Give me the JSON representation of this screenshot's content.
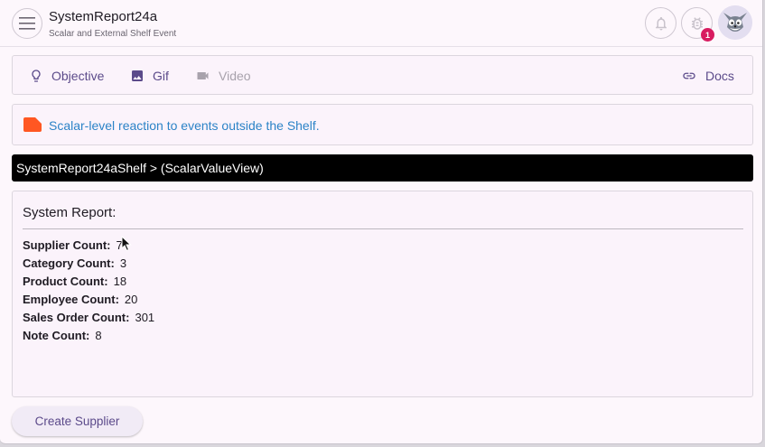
{
  "header": {
    "title": "SystemReport24a",
    "subtitle": "Scalar and External Shelf Event",
    "notification_count": "1"
  },
  "tabs": [
    {
      "label": "Objective",
      "icon": "lightbulb-icon",
      "enabled": true
    },
    {
      "label": "Gif",
      "icon": "image-icon",
      "enabled": true
    },
    {
      "label": "Video",
      "icon": "videocam-icon",
      "enabled": false
    },
    {
      "label": "Docs",
      "icon": "link-icon",
      "enabled": true
    }
  ],
  "info": {
    "icon": "label-icon",
    "icon_color": "#ff5722",
    "text": "Scalar-level reaction to events outside the Shelf."
  },
  "path": "SystemReport24aShelf > (ScalarValueView)",
  "report": {
    "title": "System Report:",
    "rows": [
      {
        "label": "Supplier Count:",
        "value": "7"
      },
      {
        "label": "Category Count:",
        "value": "3"
      },
      {
        "label": "Product Count:",
        "value": "18"
      },
      {
        "label": "Employee Count:",
        "value": "20"
      },
      {
        "label": "Sales Order Count:",
        "value": "301"
      },
      {
        "label": "Note Count:",
        "value": "8"
      }
    ]
  },
  "actions": {
    "create_supplier": "Create Supplier"
  },
  "colors": {
    "accent": "#5b4a8a",
    "info_text": "#2c83c7",
    "badge": "#d81b60"
  }
}
